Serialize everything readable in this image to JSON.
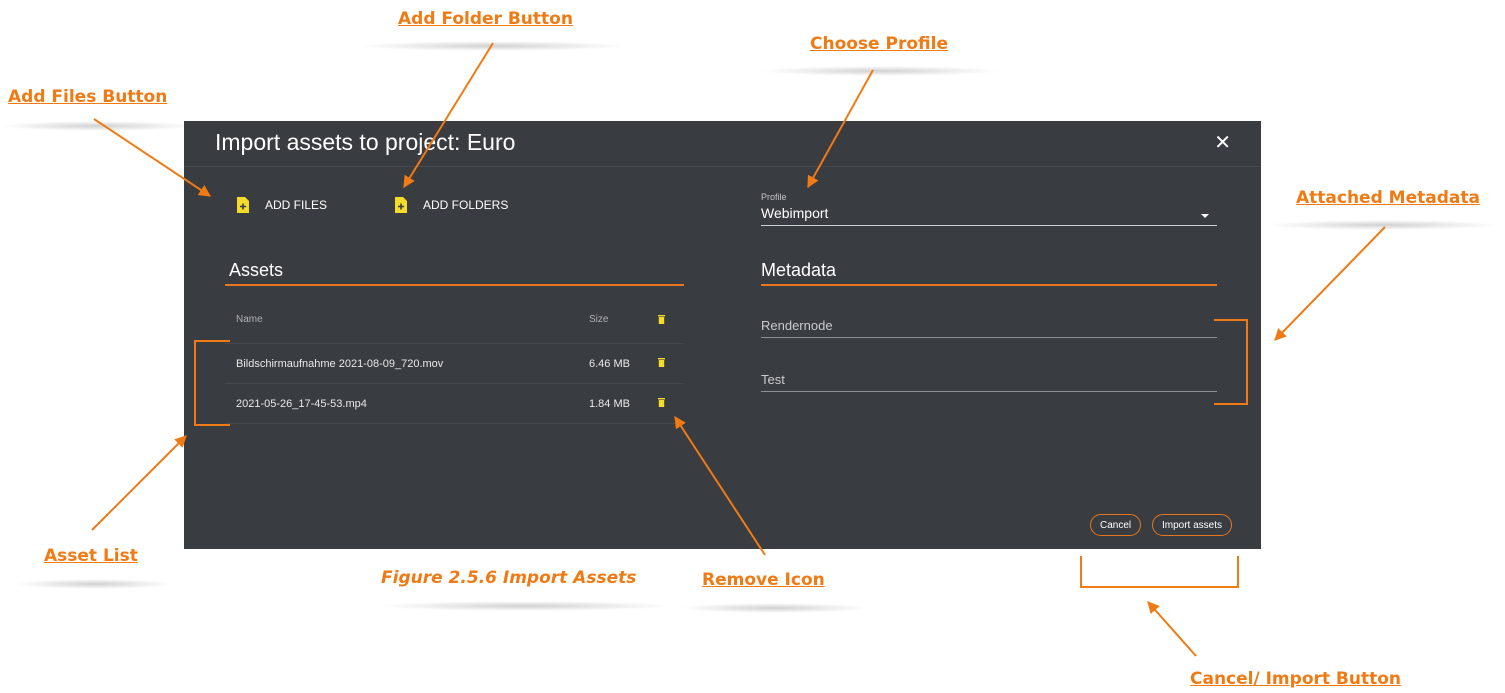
{
  "dialog": {
    "title": "Import assets to project: Euro",
    "close_glyph": "✕",
    "add_files_label": "ADD FILES",
    "add_folders_label": "ADD FOLDERS",
    "add_icon": "file-plus-icon",
    "assets": {
      "heading": "Assets",
      "columns": {
        "name": "Name",
        "size": "Size"
      },
      "rows": [
        {
          "name": "Bildschirmaufnahme 2021-08-09_720.mov",
          "size": "6.46 MB"
        },
        {
          "name": "2021-05-26_17-45-53.mp4",
          "size": "1.84 MB"
        }
      ],
      "remove_icon": "trash-icon"
    },
    "profile": {
      "label": "Profile",
      "value": "Webimport"
    },
    "metadata": {
      "heading": "Metadata",
      "fields": [
        {
          "placeholder": "Rendernode"
        },
        {
          "placeholder": "Test"
        }
      ]
    },
    "cancel_label": "Cancel",
    "import_label": "Import assets"
  },
  "annotations": {
    "add_folder_button": "Add Folder Button",
    "choose_profile": "Choose Profile",
    "add_files_button": "Add Files Button",
    "attached_metadata": "Attached Metadata",
    "asset_list": "Asset List",
    "remove_icon": "Remove Icon",
    "cancel_import_button": "Cancel/ Import Button",
    "figure_caption": "Figure 2.5.6 Import Assets"
  },
  "colors": {
    "dialog_bg": "#393c41",
    "accent": "#e8761c",
    "callout": "#f07a14",
    "icon_yellow": "#f5dc2a"
  }
}
